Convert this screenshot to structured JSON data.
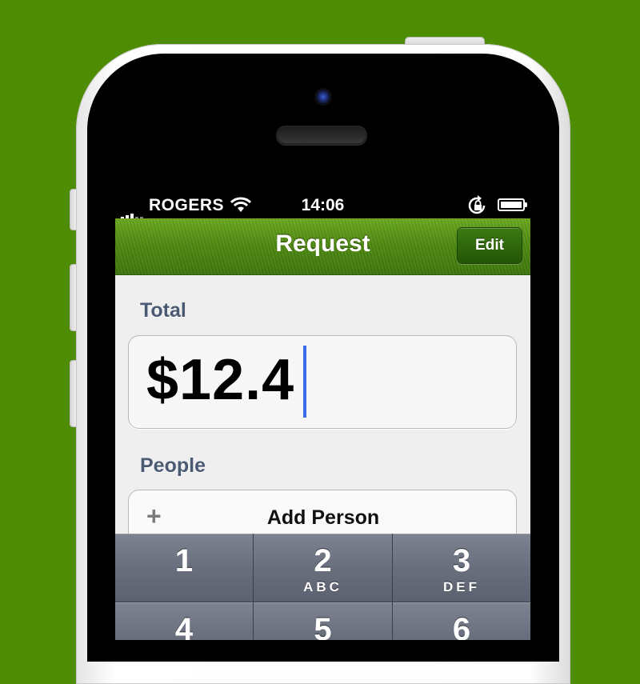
{
  "status_bar": {
    "carrier": "ROGERS",
    "time": "14:06"
  },
  "nav": {
    "title": "Request",
    "edit_label": "Edit"
  },
  "total": {
    "label": "Total",
    "value": "$12.4"
  },
  "people": {
    "label": "People",
    "add_label": "Add Person",
    "add_icon": "+"
  },
  "keypad": {
    "keys": [
      {
        "digit": "1",
        "letters": ""
      },
      {
        "digit": "2",
        "letters": "ABC"
      },
      {
        "digit": "3",
        "letters": "DEF"
      },
      {
        "digit": "4",
        "letters": ""
      },
      {
        "digit": "5",
        "letters": ""
      },
      {
        "digit": "6",
        "letters": ""
      }
    ]
  },
  "colors": {
    "background": "#4e8c03",
    "navbar": "#4f8a12",
    "caret": "#3a6ee8",
    "label_text": "#4b5a73"
  }
}
